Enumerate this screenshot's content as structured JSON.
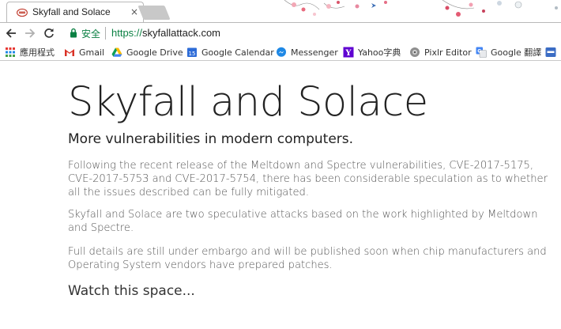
{
  "browser": {
    "tab": {
      "title": "Skyfall and Solace",
      "close_label": "×",
      "favicon": "intel-logo-icon"
    },
    "toolbar": {
      "back_icon": "back-arrow-icon",
      "forward_icon": "forward-arrow-icon",
      "reload_icon": "reload-icon",
      "security_label": "安全",
      "url_scheme": "https://",
      "url_host": "skyfallattack.com"
    },
    "bookmarks": [
      {
        "label": "應用程式",
        "icon": "apps-grid-icon"
      },
      {
        "label": "Gmail",
        "icon": "gmail-icon"
      },
      {
        "label": "Google Drive",
        "icon": "google-drive-icon"
      },
      {
        "label": "Google Calendar",
        "icon": "google-calendar-icon"
      },
      {
        "label": "Messenger",
        "icon": "messenger-icon"
      },
      {
        "label": "Yahoo字典",
        "icon": "yahoo-icon"
      },
      {
        "label": "Pixlr Editor",
        "icon": "pixlr-icon"
      },
      {
        "label": "Google 翻譯",
        "icon": "google-translate-icon"
      }
    ],
    "colors": {
      "secure_green": "#0b8043",
      "gmail_red": "#d93025",
      "calendar_blue": "#2d6bd7",
      "messenger_blue": "#1e88e5",
      "yahoo_purple": "#5f01d1"
    }
  },
  "page": {
    "title": "Skyfall and Solace",
    "subtitle": "More vulnerabilities in modern computers.",
    "paragraphs": [
      "Following the recent release of the Meltdown and Spectre vulnerabilities, CVE-2017-5175, CVE-2017-5753 and CVE-2017-5754, there has been considerable speculation as to whether all the issues described can be fully mitigated.",
      "Skyfall and Solace are two speculative attacks based on the work highlighted by Meltdown and Spectre.",
      "Full details are still under embargo and will be published soon when chip manufacturers and Operating System vendors have prepared patches."
    ],
    "closing": "Watch this space..."
  }
}
